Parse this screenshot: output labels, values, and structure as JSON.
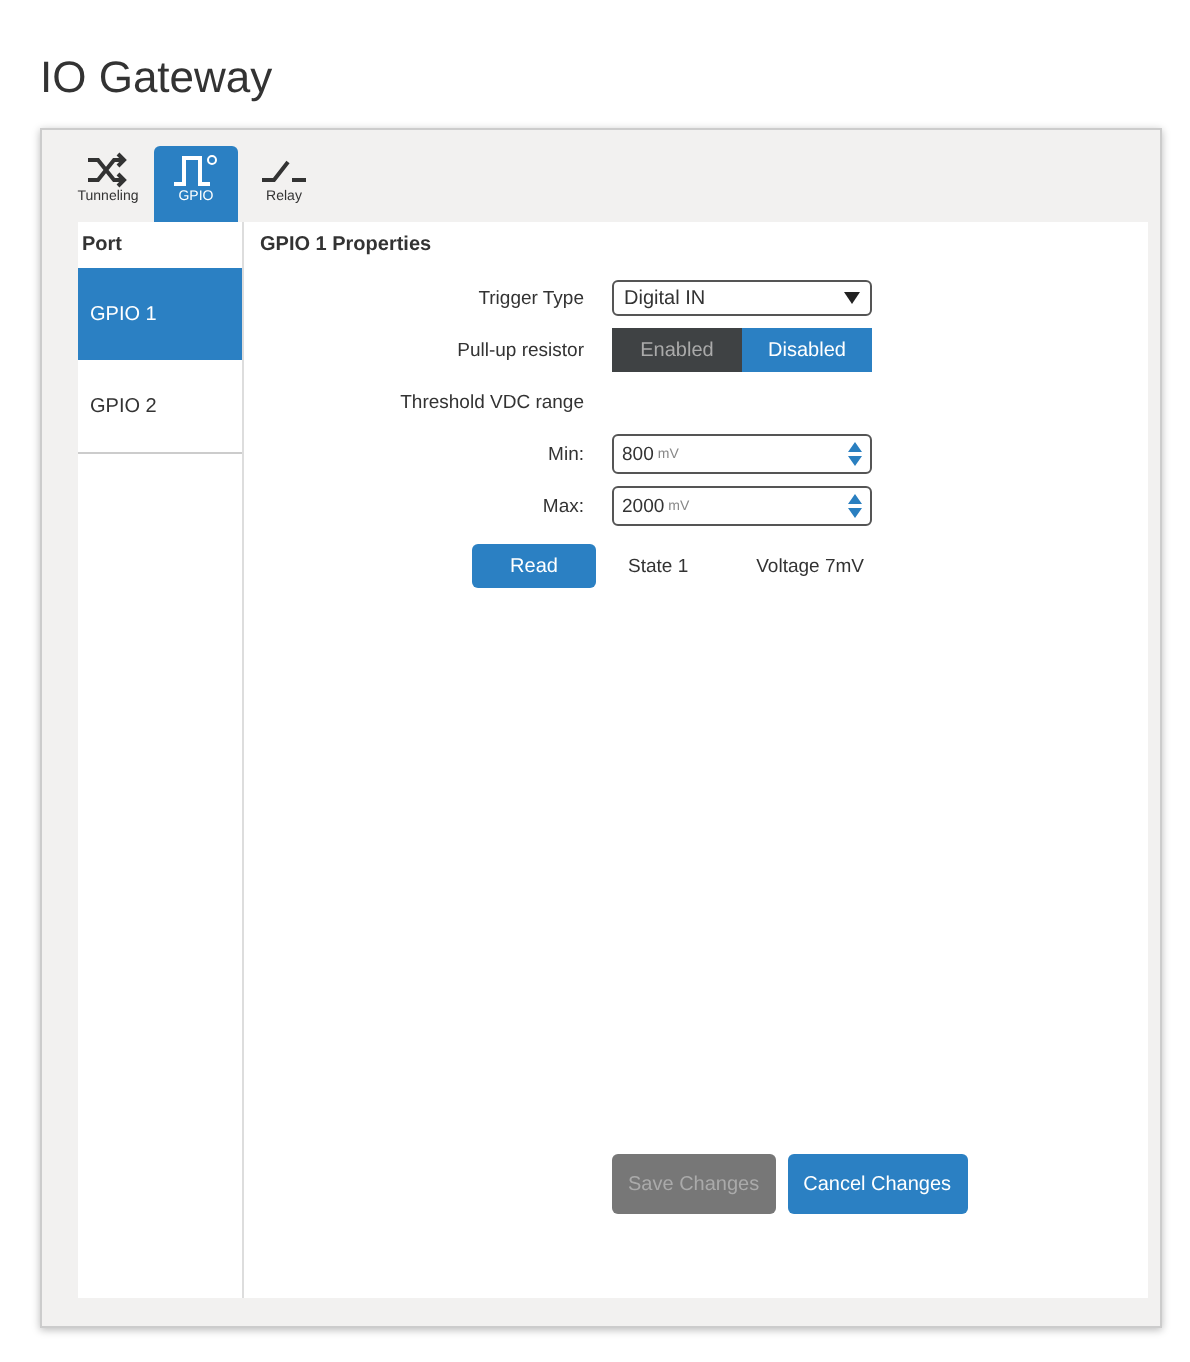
{
  "title": "IO Gateway",
  "tabs": [
    {
      "label": "Tunneling",
      "kind": "shuffle",
      "selected": false
    },
    {
      "label": "GPIO",
      "kind": "pulse",
      "selected": true
    },
    {
      "label": "Relay",
      "kind": "switch",
      "selected": false
    }
  ],
  "ports": {
    "heading": "Port",
    "items": [
      {
        "label": "GPIO 1",
        "selected": true
      },
      {
        "label": "GPIO 2",
        "selected": false
      }
    ]
  },
  "properties": {
    "heading": "GPIO 1 Properties",
    "trigger_type": {
      "label": "Trigger Type",
      "value": "Digital IN"
    },
    "pullup": {
      "label": "Pull-up resistor",
      "options": [
        {
          "label": "Enabled",
          "selected": false
        },
        {
          "label": "Disabled",
          "selected": true
        }
      ]
    },
    "threshold_label": "Threshold VDC range",
    "min": {
      "label": "Min:",
      "value": "800",
      "unit": "mV"
    },
    "max": {
      "label": "Max:",
      "value": "2000",
      "unit": "mV"
    },
    "read_button": "Read",
    "state": "State  1",
    "voltage": "Voltage  7mV"
  },
  "buttons": [
    {
      "label": "Save Changes",
      "disabled": true
    },
    {
      "label": "Cancel Changes",
      "disabled": false
    }
  ]
}
